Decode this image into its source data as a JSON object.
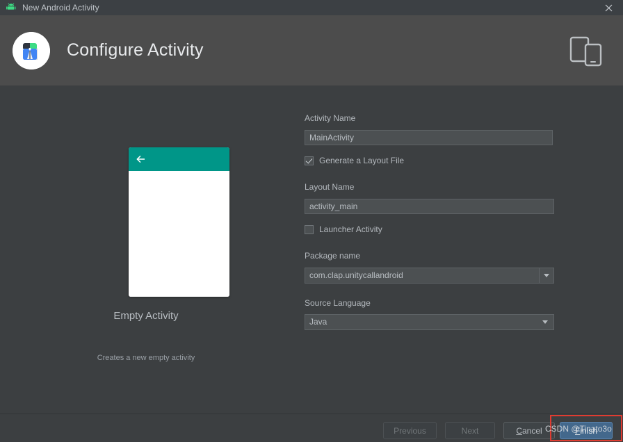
{
  "window": {
    "title": "New Android Activity",
    "icon": "android-robot-icon",
    "close_label": "✕"
  },
  "header": {
    "title": "Configure Activity",
    "logo_icon": "android-studio-icon",
    "device_icon": "tablet-and-phone-icon"
  },
  "preview": {
    "template_name": "Empty Activity",
    "description": "Creates a new empty activity",
    "appbar_color": "#009688",
    "screen_color": "#ffffff",
    "back_arrow_icon": "arrow-left-icon"
  },
  "form": {
    "activity_name": {
      "label": "Activity Name",
      "value": "MainActivity",
      "placeholder": ""
    },
    "generate_layout": {
      "label": "Generate a Layout File",
      "checked": true
    },
    "layout_name": {
      "label": "Layout Name",
      "value": "activity_main",
      "placeholder": ""
    },
    "launcher_activity": {
      "label": "Launcher Activity",
      "checked": false
    },
    "package_name": {
      "label": "Package name",
      "value": "com.clap.unitycallandroid",
      "dropdown_icon": "chevron-down-icon"
    },
    "source_language": {
      "label": "Source Language",
      "value": "Java",
      "dropdown_icon": "chevron-down-icon"
    }
  },
  "footer": {
    "previous": "Previous",
    "next": "Next",
    "cancel_prefix": "",
    "cancel_mnemonic": "C",
    "cancel_suffix": "ancel",
    "finish_prefix": "",
    "finish_mnemonic": "F",
    "finish_suffix": "inish"
  },
  "overlay": {
    "watermark": "CSDN @Tinato3o",
    "annotation_color": "#e03c31"
  },
  "colors": {
    "window_bg": "#3c3f41",
    "header_bg": "#4c4c4c",
    "titlebar_bg": "#3c4044",
    "input_bg": "#4c5052",
    "accent": "#43688c",
    "teal": "#009688"
  }
}
